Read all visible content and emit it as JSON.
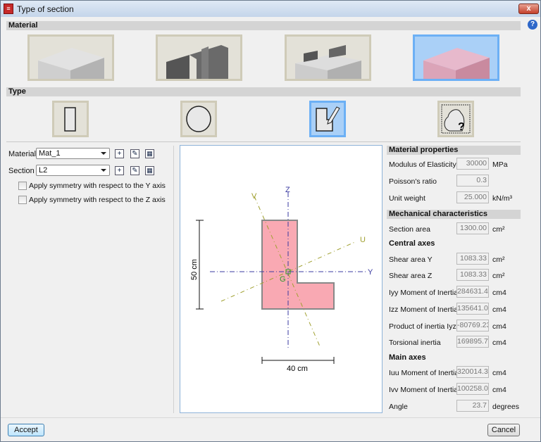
{
  "window": {
    "title": "Type of section",
    "close": "x",
    "help": "?"
  },
  "material_header": "Material",
  "type_header": "Type",
  "materials": [
    {
      "name": "concrete"
    },
    {
      "name": "steel"
    },
    {
      "name": "composite"
    },
    {
      "name": "generic",
      "selected": true
    }
  ],
  "types": [
    {
      "name": "rectangular"
    },
    {
      "name": "circular"
    },
    {
      "name": "drawn",
      "selected": true
    },
    {
      "name": "generic"
    }
  ],
  "left": {
    "material_label": "Material",
    "material_value": "Mat_1",
    "section_label": "Section",
    "section_value": "L2",
    "sym_y": "Apply symmetry with respect to the Y axis",
    "sym_z": "Apply symmetry with respect to the Z axis"
  },
  "drawing": {
    "z": "Z",
    "y": "Y",
    "u": "U",
    "v": "V",
    "g": "G",
    "height": "50 cm",
    "width": "40 cm",
    "fill": "#f9a9b3"
  },
  "right": {
    "mat_props": "Material properties",
    "elasticity_label": "Modulus of Elasticity",
    "elasticity": "30000",
    "elasticity_unit": "MPa",
    "poisson_label": "Poisson's ratio",
    "poisson": "0.3",
    "weight_label": "Unit weight",
    "weight": "25.000",
    "weight_unit": "kN/m³",
    "mech": "Mechanical characteristics",
    "area_label": "Section area",
    "area": "1300.00",
    "area_unit": "cm²",
    "central": "Central axes",
    "shear_y_label": "Shear area Y",
    "shear_y": "1083.33",
    "shear_y_unit": "cm²",
    "shear_z_label": "Shear area Z",
    "shear_z": "1083.33",
    "shear_z_unit": "cm²",
    "iyy_label": "Iyy Moment of Inertia",
    "iyy": "284631.4",
    "iyy_unit": "cm4",
    "izz_label": "Izz Moment of Inertia",
    "izz": "135641.0",
    "izz_unit": "cm4",
    "iyz_label": "Product of inertia Iyz",
    "iyz": "-80769.23",
    "iyz_unit": "cm4",
    "tor_label": "Torsional inertia",
    "tor": "169895.7",
    "tor_unit": "cm4",
    "main": "Main axes",
    "iuu_label": "Iuu Moment of Inertia",
    "iuu": "320014.3",
    "iuu_unit": "cm4",
    "ivv_label": "Ivv Moment of Inertia",
    "ivv": "100258.0",
    "ivv_unit": "cm4",
    "angle_label": "Angle",
    "angle": "23.7",
    "angle_unit": "degrees"
  },
  "buttons": {
    "accept": "Accept",
    "cancel": "Cancel"
  }
}
